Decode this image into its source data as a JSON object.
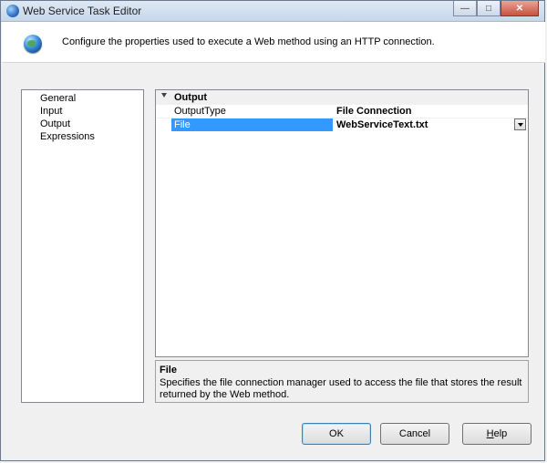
{
  "window": {
    "title": "Web Service Task Editor"
  },
  "header": {
    "text": "Configure the properties used to execute a Web method using an HTTP connection."
  },
  "nav": {
    "items": [
      "General",
      "Input",
      "Output",
      "Expressions"
    ]
  },
  "grid": {
    "category": "Output",
    "properties": [
      {
        "name": "OutputType",
        "value": "File Connection"
      },
      {
        "name": "File",
        "value": "WebServiceText.txt"
      }
    ]
  },
  "description": {
    "title": "File",
    "text": "Specifies the file connection manager used to access the file that stores the result returned by the Web method."
  },
  "buttons": {
    "ok": "OK",
    "cancel": "Cancel",
    "help_first": "H",
    "help_rest": "elp"
  },
  "colors": {
    "selection": "#3399ff",
    "title_gradient_top": "#dfe9f5"
  }
}
